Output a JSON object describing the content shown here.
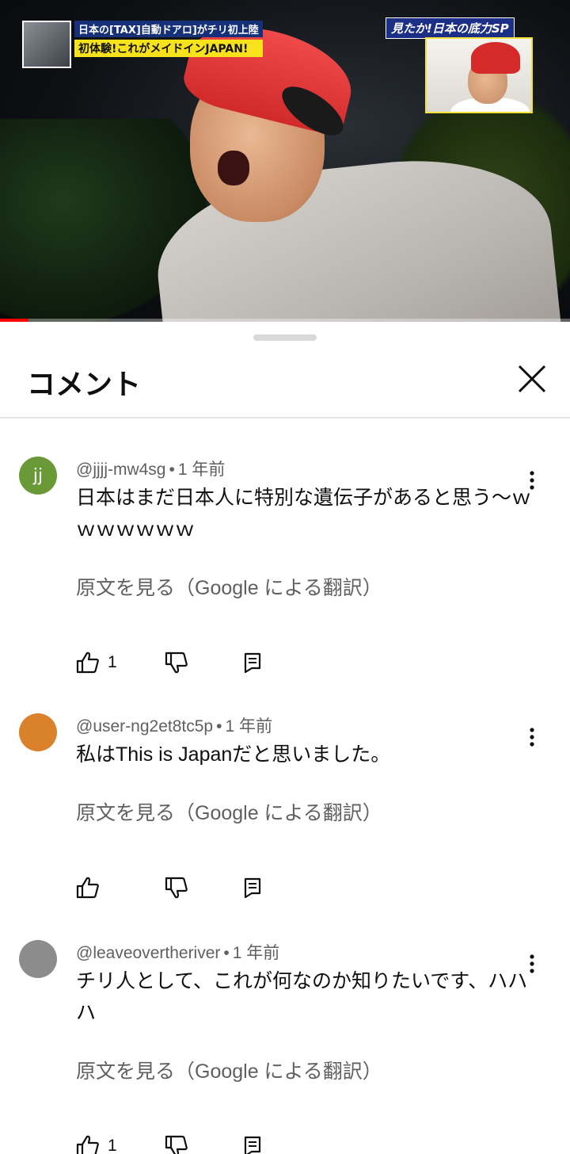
{
  "video": {
    "caption_line1": "日本の[TAX]自動ドアロ]がチリ初上陸",
    "caption_line2": "初体験!これがメイドインJAPAN!",
    "badge": "見たか!日本の底力SP",
    "progress_fraction": 0.05,
    "progress_color": "#ff0000"
  },
  "sheet": {
    "title": "コメント",
    "close_icon": "close-icon"
  },
  "comments": [
    {
      "handle": "@jjjj-mw4sg",
      "separator": "•",
      "time": "1 年前",
      "avatar_letter": "jj",
      "avatar_color": "#6a9a37",
      "text": "日本はまだ日本人に特別な遺伝子があると思う〜ｗｗｗｗｗｗｗ",
      "translate_label": "原文を見る（Google による翻訳）",
      "like_count": "1"
    },
    {
      "handle": "@user-ng2et8tc5p",
      "separator": "•",
      "time": "1 年前",
      "avatar_letter": "",
      "avatar_color": "#d9822b",
      "text": "私はThis is Japanだと思いました。",
      "translate_label": "原文を見る（Google による翻訳）",
      "like_count": ""
    },
    {
      "handle": "@leaveovertheriver",
      "separator": "•",
      "time": "1 年前",
      "avatar_letter": "",
      "avatar_color": "#8c8c8c",
      "text": "チリ人として、これが何なのか知りたいです、ハハハ",
      "translate_label": "原文を見る（Google による翻訳）",
      "like_count": "1"
    }
  ],
  "icons": {
    "like": "thumb-up-icon",
    "dislike": "thumb-down-icon",
    "reply": "reply-icon",
    "more": "more-vert-icon"
  }
}
